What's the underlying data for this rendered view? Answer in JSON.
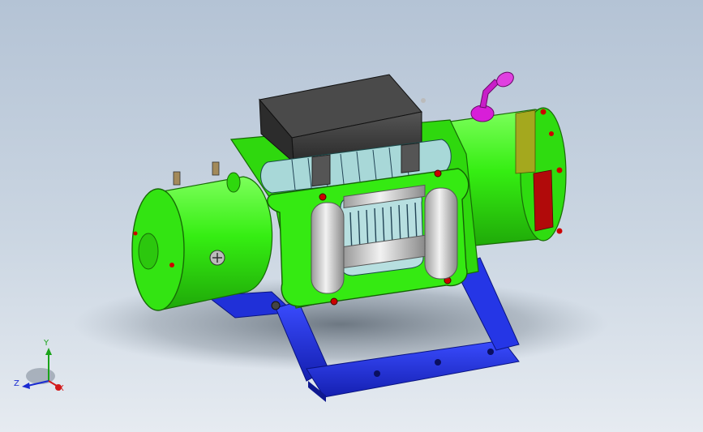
{
  "viewport": {
    "background_top": "#b4c3d5",
    "background_bottom": "#e6ebf1"
  },
  "model": {
    "parts": [
      {
        "name": "motor-housing",
        "color": "#33ee11"
      },
      {
        "name": "gearbox-housing",
        "color": "#33ee11"
      },
      {
        "name": "control-box",
        "color": "#3a3a3a"
      },
      {
        "name": "cable-drum",
        "color": "#a8d8d8"
      },
      {
        "name": "fairlead-rollers",
        "color": "#cfcfcf"
      },
      {
        "name": "mounting-bracket",
        "color": "#2233dd"
      },
      {
        "name": "brake-band-yellow",
        "color": "#a4a81e"
      },
      {
        "name": "brake-band-red",
        "color": "#b10a0a"
      },
      {
        "name": "breather-vent",
        "color": "#d81ed8"
      }
    ]
  },
  "triad": {
    "x_label": "X",
    "y_label": "Y",
    "z_label": "Z",
    "x_color": "#d21a1a",
    "y_color": "#1aa31a",
    "z_color": "#1a2bd2"
  }
}
